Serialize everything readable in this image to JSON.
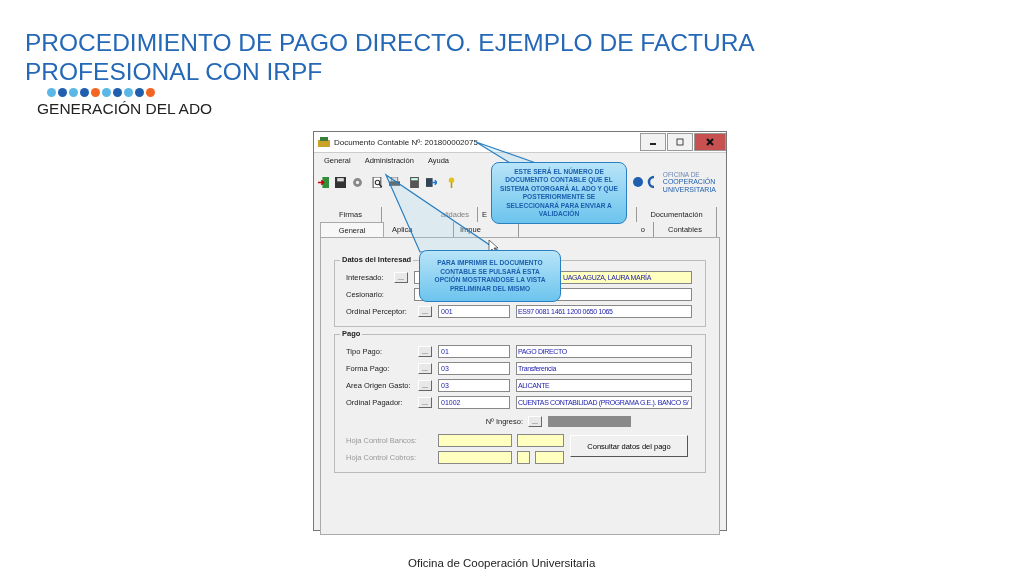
{
  "slide": {
    "title": "PROCEDIMIENTO DE PAGO DIRECTO. EJEMPLO DE FACTURA PROFESIONAL CON IRPF",
    "dots": [
      {
        "color": "#5bb8e6"
      },
      {
        "color": "#1f5fae"
      },
      {
        "color": "#5bb8e6"
      },
      {
        "color": "#1f5fae"
      },
      {
        "color": "#f26522"
      },
      {
        "color": "#5bb8e6"
      },
      {
        "color": "#1f5fae"
      },
      {
        "color": "#5bb8e6"
      },
      {
        "color": "#1f5fae"
      },
      {
        "color": "#f26522"
      }
    ],
    "subtitle": "GENERACIÓN DEL ADO",
    "footer": "Oficina de Cooperación Universitaria"
  },
  "window": {
    "title": "Documento Contable Nº: 201800002075",
    "menu": [
      "General",
      "Administración",
      "Ayuda"
    ],
    "logo_lines": [
      "OFICINA DE",
      "COOPERACIÓN",
      "UNIVERSITARIA"
    ],
    "tab_rows": [
      [
        {
          "label": "Firmas",
          "selected": false,
          "disabled": false
        },
        {
          "label": "alidades",
          "selected": false,
          "disabled": true
        },
        {
          "label": "E",
          "selected": false,
          "disabled": false
        },
        {
          "label": "Documentación",
          "selected": false,
          "disabled": false
        }
      ],
      [
        {
          "label": "General",
          "selected": true,
          "disabled": false
        },
        {
          "label": "Aplica",
          "selected": false,
          "disabled": false
        },
        {
          "label": "Impue",
          "selected": false,
          "disabled": false
        },
        {
          "label": "o",
          "selected": false,
          "disabled": false
        },
        {
          "label": "Contables",
          "selected": false,
          "disabled": false
        }
      ]
    ],
    "interesado_group": {
      "title": "Datos del Interesad",
      "rows": [
        {
          "label": "Interesado:",
          "lookup": "...",
          "description": "UAGA AGUZA, LAURA MARÍA",
          "highlighted": true
        },
        {
          "label": "Cesionario:",
          "highlighted": false
        },
        {
          "label": "Ordinal Perceptor:",
          "lookup": "...",
          "code": "001",
          "description": "ES97 0081 1461 1200 0650 1065",
          "highlighted": false
        }
      ]
    },
    "pago_group": {
      "title": "Pago",
      "rows": [
        {
          "label": "Tipo Pago:",
          "lookup": "...",
          "code": "01",
          "description": "PAGO DIRECTO",
          "highlighted": false
        },
        {
          "label": "Forma Pago:",
          "lookup": "...",
          "code": "03",
          "description": "Transferencia",
          "highlighted": false
        },
        {
          "label": "Area Origen Gasto:",
          "lookup": "...",
          "code": "03",
          "description": "ALICANTE",
          "highlighted": false
        },
        {
          "label": "Ordinal Pagador:",
          "lookup": "...",
          "code": "01002",
          "description": "CUENTAS CONTABILIDAD (PROGRAMA G.E.). BANCO S/",
          "highlighted": false
        }
      ],
      "ingreso": {
        "label": "Nº Ingreso:",
        "lookup": "...",
        "disabled": true
      },
      "control_rows": [
        {
          "label": "Hoja Control Bancos:",
          "disabled": true,
          "fields": [
            {
              "highlighted": true
            },
            {
              "highlighted": true
            }
          ]
        },
        {
          "label": "Hoja Control Cobros:",
          "disabled": true,
          "fields": [
            {
              "highlighted": true
            },
            {
              "highlighted": true
            },
            {
              "highlighted": true
            }
          ]
        }
      ],
      "button": "Consultar datos del pago"
    }
  },
  "callouts": [
    {
      "text": "ESTE SERÁ EL NÚMERO DE DOCUMENTO CONTABLE QUE EL SISTEMA OTORGARÁ AL ADO Y QUE POSTERIORMENTE SE SELECCIONARÁ PARA ENVIAR A VALIDACIÓN"
    },
    {
      "text": "PARA IMPRIMIR EL DOCUMENTO CONTABLE SE PULSARÁ ESTA OPCIÓN MOSTRANDOSE LA VISTA PRELIMINAR DEL MISMO"
    }
  ]
}
